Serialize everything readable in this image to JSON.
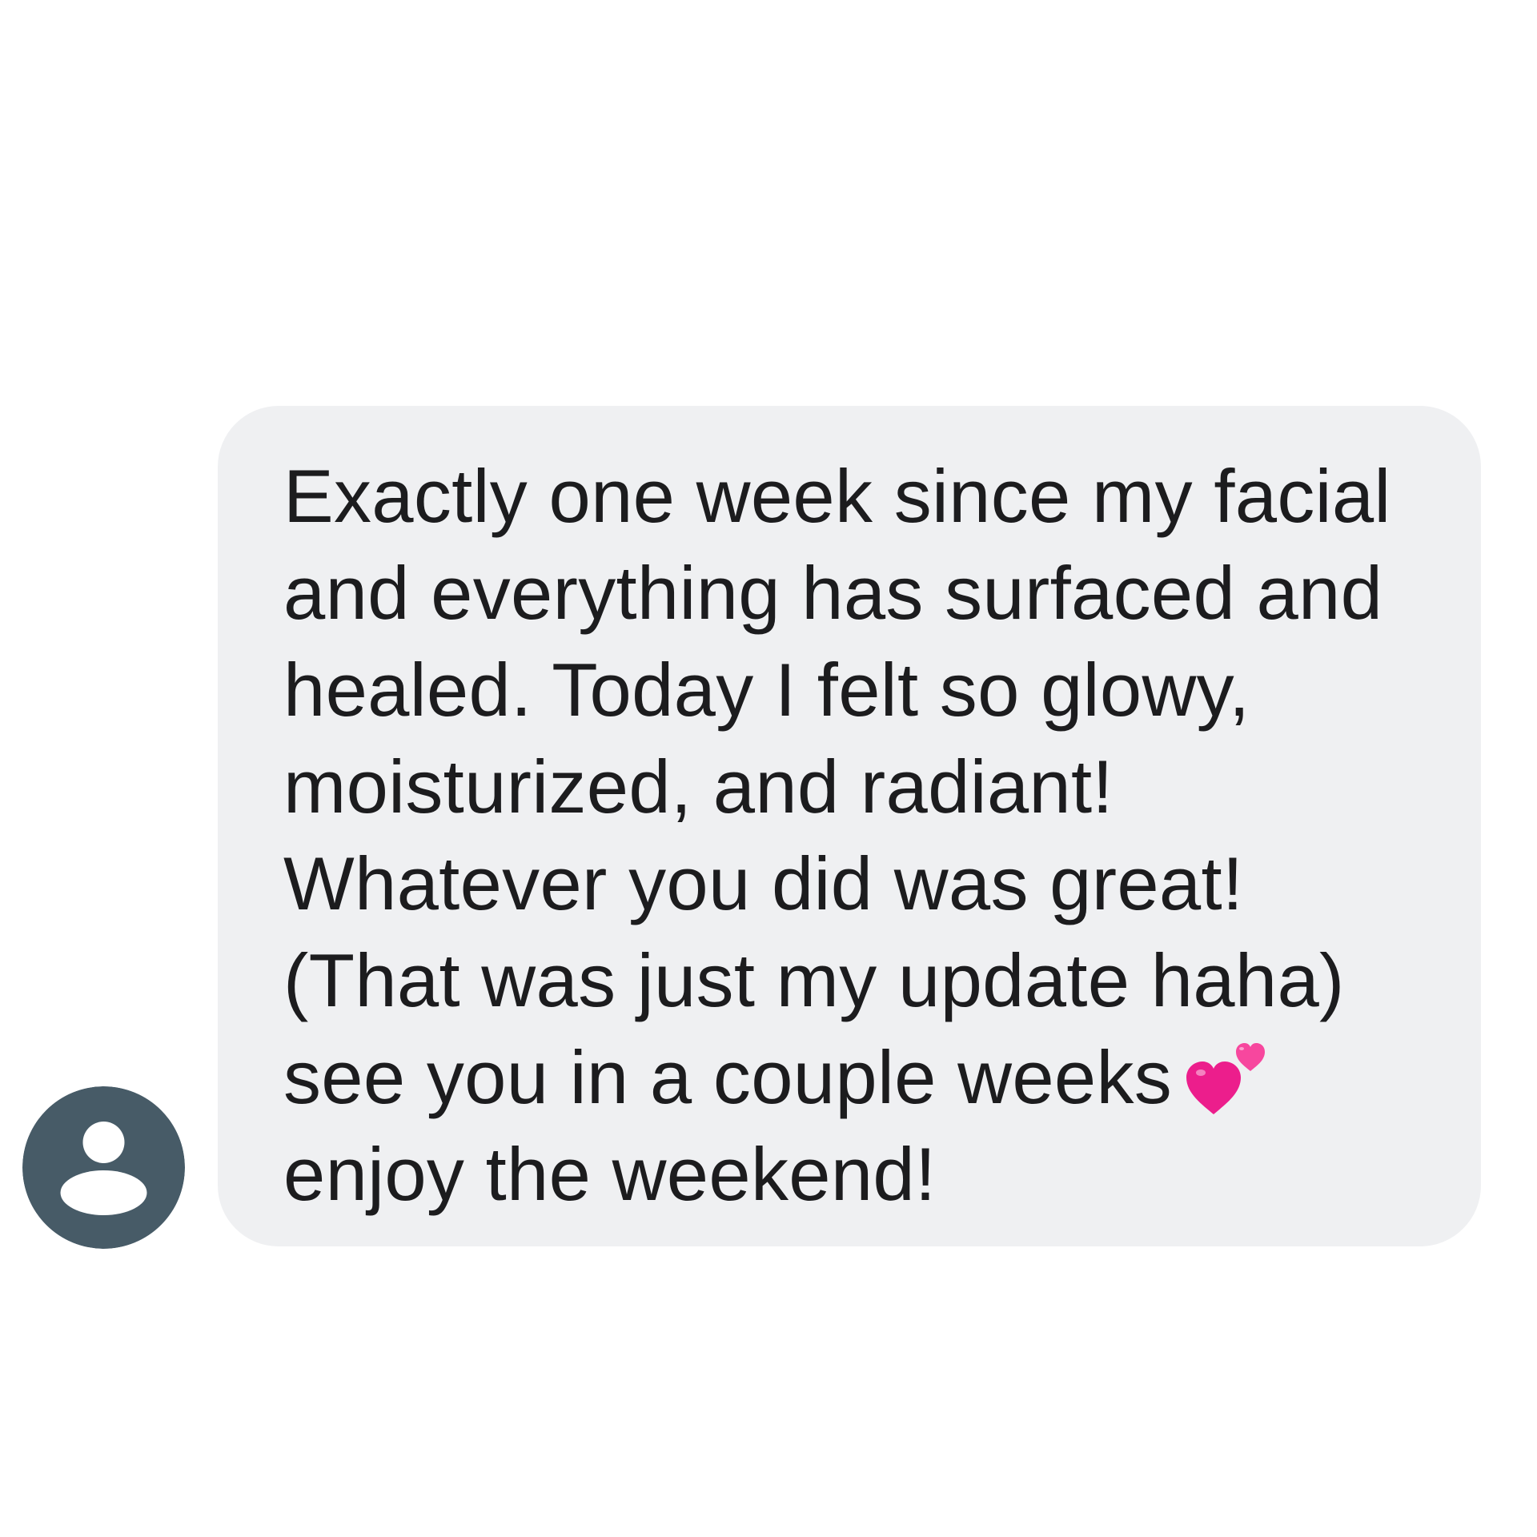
{
  "colors": {
    "background": "#ffffff",
    "bubble": "#eff0f2",
    "text": "#1c1c1e",
    "avatar_bg": "#475b67",
    "avatar_fg": "#ffffff",
    "heart_primary": "#ec1e8c",
    "heart_secondary": "#f7479e"
  },
  "contact": {
    "avatar_icon": "person-silhouette-icon"
  },
  "message": {
    "lines": [
      "Exactly one week since my facial",
      "and everything has surfaced and",
      "healed. Today I felt so glowy,",
      "moisturized, and radiant!",
      "Whatever you did was great!",
      "(That was just my update haha)",
      "see you in a couple weeks",
      "enjoy the weekend!"
    ],
    "emoji_icon": "two-hearts-icon"
  }
}
